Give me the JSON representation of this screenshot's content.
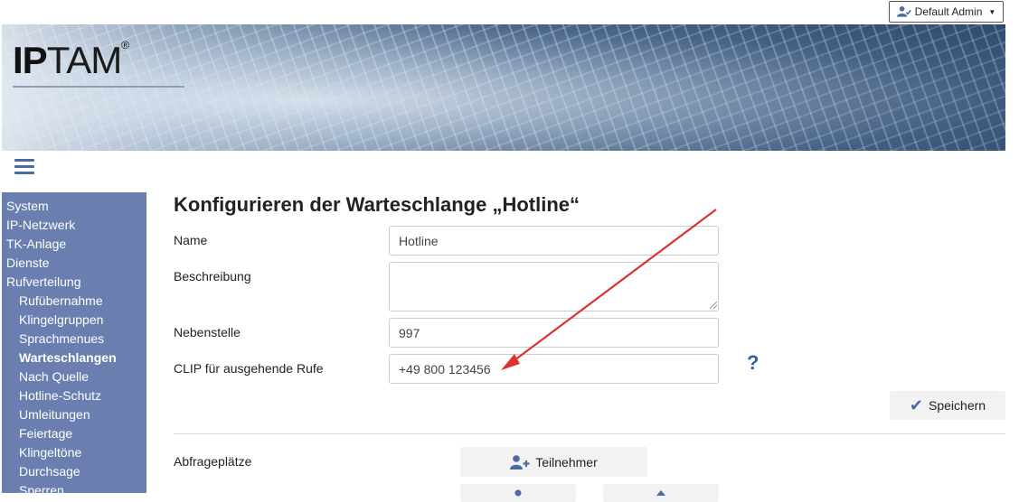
{
  "header": {
    "user_menu_label": "Default Admin",
    "logo_bold": "IP",
    "logo_light": "TAM",
    "logo_mark": "®"
  },
  "sidebar": {
    "items": [
      {
        "label": "System",
        "level": 0,
        "active": false
      },
      {
        "label": "IP-Netzwerk",
        "level": 0,
        "active": false
      },
      {
        "label": "TK-Anlage",
        "level": 0,
        "active": false
      },
      {
        "label": "Dienste",
        "level": 0,
        "active": false
      },
      {
        "label": "Rufverteilung",
        "level": 0,
        "active": false
      },
      {
        "label": "Rufübernahme",
        "level": 1,
        "active": false
      },
      {
        "label": "Klingelgruppen",
        "level": 1,
        "active": false
      },
      {
        "label": "Sprachmenues",
        "level": 1,
        "active": false
      },
      {
        "label": "Warteschlangen",
        "level": 1,
        "active": true
      },
      {
        "label": "Nach Quelle",
        "level": 1,
        "active": false
      },
      {
        "label": "Hotline-Schutz",
        "level": 1,
        "active": false
      },
      {
        "label": "Umleitungen",
        "level": 1,
        "active": false
      },
      {
        "label": "Feiertage",
        "level": 1,
        "active": false
      },
      {
        "label": "Klingeltöne",
        "level": 1,
        "active": false
      },
      {
        "label": "Durchsage",
        "level": 1,
        "active": false
      },
      {
        "label": "Sperren",
        "level": 1,
        "active": false
      }
    ]
  },
  "main": {
    "title": "Konfigurieren der Warteschlange „Hotline“",
    "form": {
      "name_label": "Name",
      "name_value": "Hotline",
      "description_label": "Beschreibung",
      "description_value": "",
      "extension_label": "Nebenstelle",
      "extension_value": "997",
      "clip_label": "CLIP für ausgehende Rufe",
      "clip_value": "+49 800 123456",
      "help_label": "?"
    },
    "save_label": "Speichern",
    "agents_label": "Abfrageplätze",
    "add_participant_label": "Teilnehmer"
  },
  "colors": {
    "sidebar_bg": "#6a7fb0",
    "accent": "#4a6aa0",
    "annotation_arrow": "#e03030"
  }
}
